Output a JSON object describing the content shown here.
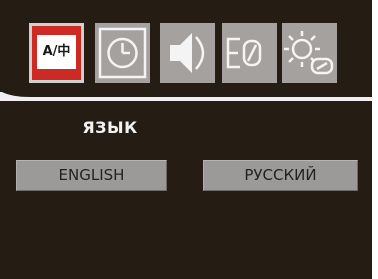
{
  "menu": {
    "tabs": [
      {
        "id": "language",
        "icon": "language-icon",
        "label": "A/中",
        "selected": true
      },
      {
        "id": "clock",
        "icon": "clock-icon",
        "selected": false
      },
      {
        "id": "audio",
        "icon": "speaker-icon",
        "selected": false
      },
      {
        "id": "input",
        "icon": "input-source-icon",
        "selected": false
      },
      {
        "id": "picture",
        "icon": "brightness-settings-icon",
        "selected": false
      }
    ],
    "title": "ЯЗЫК",
    "options": [
      {
        "label": "ENGLISH",
        "selected": false
      },
      {
        "label": "РУССКИЙ",
        "selected": false
      }
    ]
  },
  "colors": {
    "background": "#251c14",
    "language_tab_accent": "#cc2a22",
    "tab_bg": "#a09d9a",
    "button_bg": "#9c9a98",
    "title_text": "#f2f2f2"
  }
}
